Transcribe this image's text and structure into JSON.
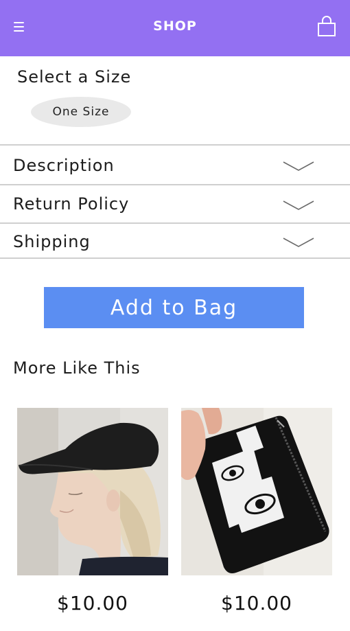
{
  "header": {
    "title": "SHOP",
    "menu_icon": "hamburger-menu-icon",
    "bag_icon": "shopping-bag-icon",
    "background": "#9370f2"
  },
  "size_selector": {
    "heading": "Select a Size",
    "options": [
      "One Size"
    ]
  },
  "accordion": [
    {
      "label": "Description",
      "icon": "chevron-down-icon"
    },
    {
      "label": "Return Policy",
      "icon": "chevron-down-icon"
    },
    {
      "label": "Shipping",
      "icon": "chevron-down-icon"
    }
  ],
  "add_to_bag": {
    "label": "Add to Bag",
    "color": "#5b8ef2"
  },
  "more_like_this": {
    "heading": "More Like This",
    "products": [
      {
        "image": "woman-in-black-flat-cap",
        "price": "$10.00"
      },
      {
        "image": "black-zip-pouch-with-eye-print",
        "price": "$10.00"
      }
    ]
  }
}
